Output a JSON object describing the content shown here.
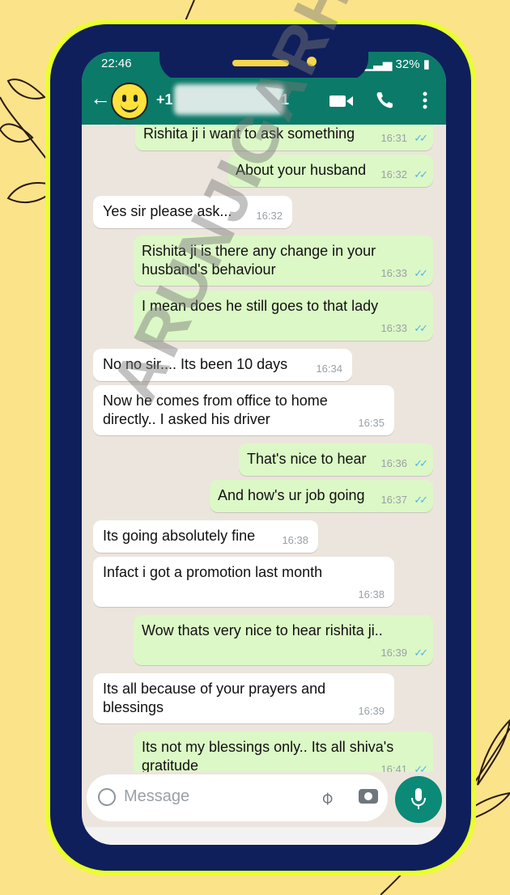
{
  "status": {
    "time": "22:46",
    "battery": "32%"
  },
  "header": {
    "contact_prefix": "+1",
    "contact_suffix": "1"
  },
  "messages": [
    {
      "dir": "out",
      "text": "Rishita ji i want to ask something",
      "time": "16:31"
    },
    {
      "dir": "out",
      "text": "About your husband",
      "time": "16:32"
    },
    {
      "dir": "in",
      "text": "Yes sir please ask...",
      "time": "16:32"
    },
    {
      "dir": "out",
      "text": "Rishita ji is there any change in your husband's behaviour",
      "time": "16:33"
    },
    {
      "dir": "out",
      "text": "I mean does he still goes to that lady",
      "time": "16:33"
    },
    {
      "dir": "in",
      "text": "No no sir.... Its been 10 days",
      "time": "16:34"
    },
    {
      "dir": "in",
      "text": "Now he comes from office to home directly.. I asked his driver",
      "time": "16:35"
    },
    {
      "dir": "out",
      "text": "That's nice to hear",
      "time": "16:36"
    },
    {
      "dir": "out",
      "text": "And how's ur job going",
      "time": "16:37"
    },
    {
      "dir": "in",
      "text": "Its going absolutely fine",
      "time": "16:38"
    },
    {
      "dir": "in",
      "text": "Infact i got a promotion last month",
      "time": "16:38"
    },
    {
      "dir": "out",
      "text": "Wow thats very nice to hear rishita ji..",
      "time": "16:39"
    },
    {
      "dir": "in",
      "text": "Its all because of your prayers and blessings",
      "time": "16:39"
    },
    {
      "dir": "out",
      "text": "Its not my blessings only.. Its all shiva's gratitude",
      "time": "16:41"
    }
  ],
  "input": {
    "placeholder": "Message"
  },
  "watermark": "ARUNJIGARH",
  "colors": {
    "header": "#0b7a69",
    "outgoing_bubble": "#dcf8c6",
    "incoming_bubble": "#ffffff",
    "ticks": "#4fb6ec",
    "frame": "#0f1f5c",
    "frame_glow": "#eaff2e",
    "background": "#fbe38a"
  },
  "icons": [
    "back-arrow-icon",
    "video-call-icon",
    "phone-icon",
    "more-vert-icon",
    "emoji-icon",
    "attach-icon",
    "camera-icon",
    "mic-icon"
  ]
}
